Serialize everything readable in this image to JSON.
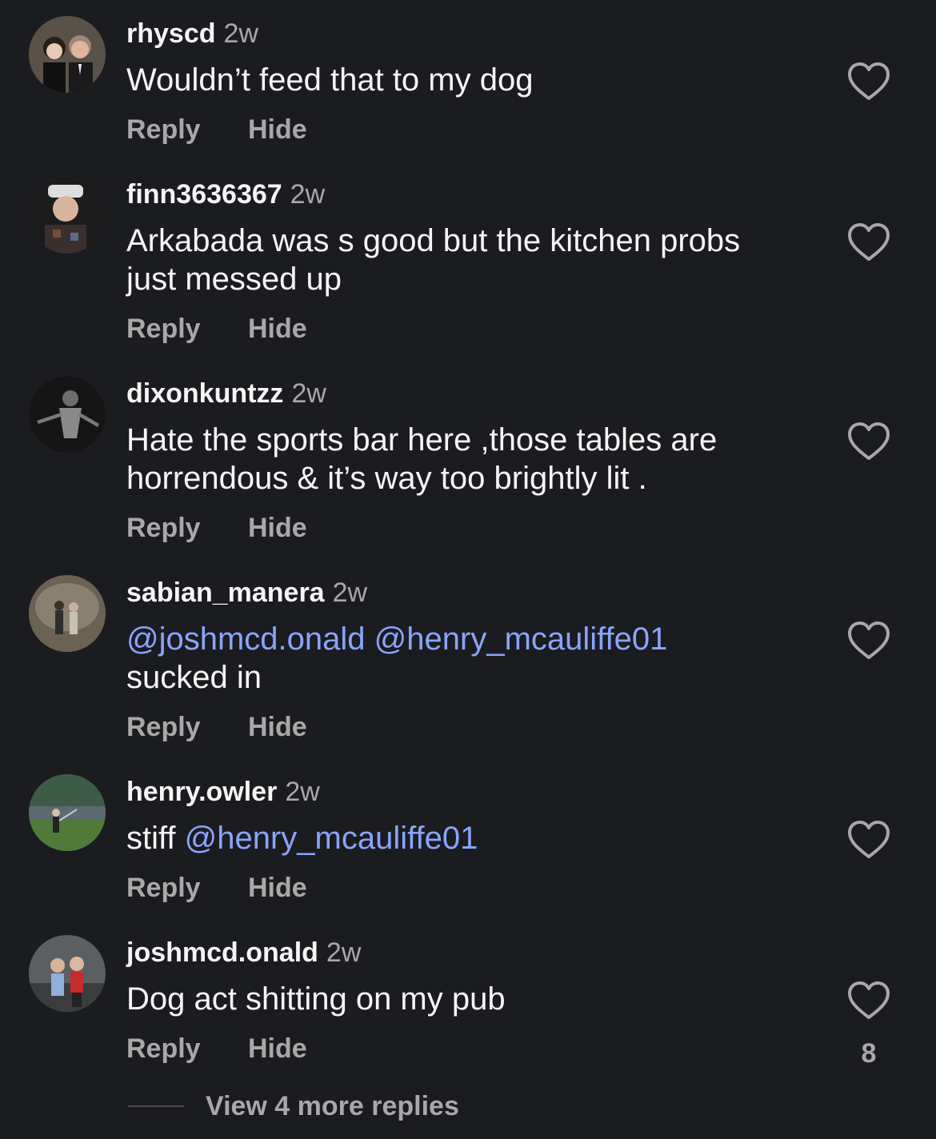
{
  "comments": [
    {
      "username": "rhyscd",
      "time": "2w",
      "text": "Wouldn’t feed that to my dog",
      "reply_label": "Reply",
      "hide_label": "Hide"
    },
    {
      "username": "finn3636367",
      "time": "2w",
      "text": "Arkabada was s good but the kitchen probs just messed up",
      "reply_label": "Reply",
      "hide_label": "Hide"
    },
    {
      "username": "dixonkuntzz",
      "time": "2w",
      "text": "Hate the sports bar here ,those tables are horrendous & it’s way too brightly lit .",
      "reply_label": "Reply",
      "hide_label": "Hide"
    },
    {
      "username": "sabian_manera",
      "time": "2w",
      "mention_1": "@joshmcd.onald",
      "mention_2": "@henry_mcauliffe01",
      "text_after": "sucked in",
      "reply_label": "Reply",
      "hide_label": "Hide"
    },
    {
      "username": "henry.owler",
      "time": "2w",
      "text_before": "stiff",
      "mention_1": "@henry_mcauliffe01",
      "reply_label": "Reply",
      "hide_label": "Hide"
    },
    {
      "username": "joshmcd.onald",
      "time": "2w",
      "text": "Dog act shitting on my pub",
      "reply_label": "Reply",
      "hide_label": "Hide",
      "like_count": "8"
    }
  ],
  "view_more_label": "View 4 more replies",
  "colors": {
    "background": "#1b1c1f",
    "primary_text": "#f5f5f5",
    "secondary_text": "#a8a8a8",
    "mention": "#8aa4ff"
  },
  "icons": {
    "like": "heart-outline-icon"
  }
}
